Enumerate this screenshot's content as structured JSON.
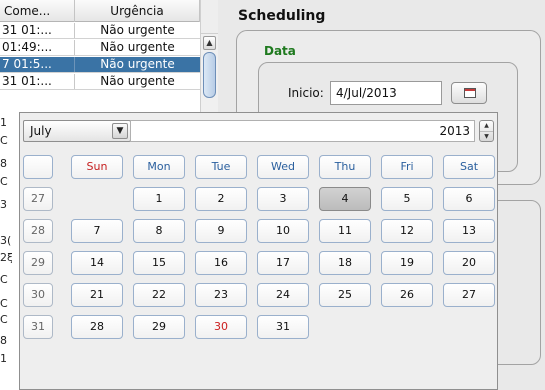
{
  "table": {
    "columns": [
      "Come...",
      "Urgência"
    ],
    "rows": [
      {
        "col1": "31 01:...",
        "col2": "Não urgente",
        "selected": false
      },
      {
        "col1": "01:49:...",
        "col2": "Não urgente",
        "selected": false
      },
      {
        "col1": "7 01:5...",
        "col2": "Não urgente",
        "selected": true
      },
      {
        "col1": "31 01:...",
        "col2": "Não urgente",
        "selected": false
      }
    ],
    "truncated": [
      "1",
      "C",
      "8",
      "C",
      "3",
      "3(",
      "2ξ",
      "C",
      "C",
      "C",
      "8",
      "1"
    ]
  },
  "scheduling": {
    "title": "Scheduling",
    "group_label": "Data",
    "inicio_label": "Inicio:",
    "inicio_value": "4/Jul/2013"
  },
  "calendar": {
    "month": "July",
    "year": "2013",
    "weekdays": [
      "Sun",
      "Mon",
      "Tue",
      "Wed",
      "Thu",
      "Fri",
      "Sat"
    ],
    "weeks": [
      {
        "week": "27",
        "days": [
          "",
          "1",
          "2",
          "3",
          "4",
          "5",
          "6"
        ]
      },
      {
        "week": "28",
        "days": [
          "7",
          "8",
          "9",
          "10",
          "11",
          "12",
          "13"
        ]
      },
      {
        "week": "29",
        "days": [
          "14",
          "15",
          "16",
          "17",
          "18",
          "19",
          "20"
        ]
      },
      {
        "week": "30",
        "days": [
          "21",
          "22",
          "23",
          "24",
          "25",
          "26",
          "27"
        ]
      },
      {
        "week": "31",
        "days": [
          "28",
          "29",
          "30",
          "31",
          "",
          "",
          ""
        ]
      }
    ],
    "today": "4",
    "highlight_red_day": "30"
  }
}
